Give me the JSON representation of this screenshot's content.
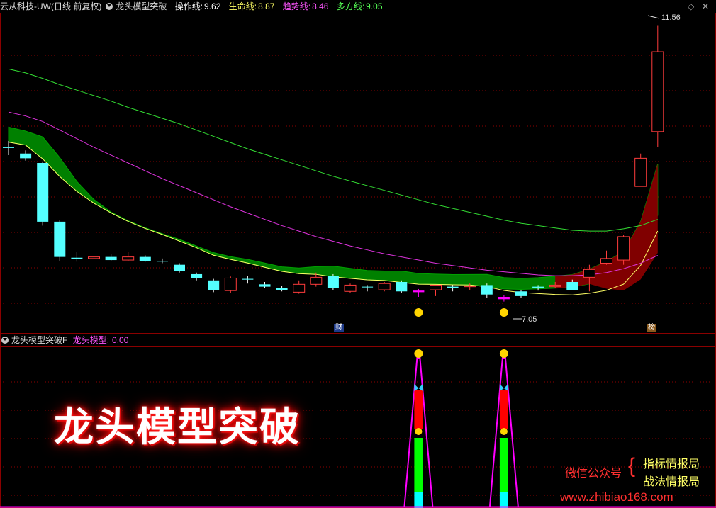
{
  "header_main": {
    "app_name": "云从科技-UW",
    "period": "(日线 前复权)",
    "indicator_name": "龙头模型突破",
    "lines": [
      {
        "label": "操作线:",
        "value": "9.62",
        "color": "#ffffff"
      },
      {
        "label": "生命线:",
        "value": "8.87",
        "color": "#ffff66"
      },
      {
        "label": "趋势线:",
        "value": "8.46",
        "color": "#ff55ff"
      },
      {
        "label": "多方线:",
        "value": "9.05",
        "color": "#55ff55"
      }
    ]
  },
  "header_sub": {
    "indicator_name": "龙头模型突破F",
    "label": "龙头模型:",
    "value": "0.00"
  },
  "price_labels": {
    "high": "11.56",
    "low": "7.05"
  },
  "markers": {
    "finance": "财",
    "rank": "榜"
  },
  "overlay_title": "龙头模型突破",
  "watermark": {
    "wechat": "微信公众号",
    "brace": "{",
    "name1": "指标情报局",
    "name2": "战法情报局",
    "url": "www.zhibiao168.com"
  },
  "colors": {
    "up": "#ff3c3c",
    "down": "#54ffff",
    "signal": "#ff00ff",
    "band": "#008000",
    "band_red": "#800000",
    "ma_green": "#33dd33",
    "ma_magenta": "#dd33dd",
    "ma_yellow": "#ffff66",
    "grid": "#8b0000"
  },
  "chart_data": {
    "type": "candlestick",
    "candles": [
      {
        "o": 10.0,
        "h": 10.08,
        "l": 9.9,
        "c": 10.0
      },
      {
        "o": 9.92,
        "h": 9.96,
        "l": 9.83,
        "c": 9.86
      },
      {
        "o": 9.8,
        "h": 9.82,
        "l": 9.0,
        "c": 9.05
      },
      {
        "o": 9.05,
        "h": 9.07,
        "l": 8.55,
        "c": 8.6
      },
      {
        "o": 8.59,
        "h": 8.66,
        "l": 8.54,
        "c": 8.57
      },
      {
        "o": 8.58,
        "h": 8.62,
        "l": 8.52,
        "c": 8.6
      },
      {
        "o": 8.56,
        "h": 8.64,
        "l": 8.55,
        "c": 8.6
      },
      {
        "o": 8.6,
        "h": 8.66,
        "l": 8.55,
        "c": 8.56
      },
      {
        "o": 8.6,
        "h": 8.62,
        "l": 8.54,
        "c": 8.55
      },
      {
        "o": 8.55,
        "h": 8.58,
        "l": 8.52,
        "c": 8.54
      },
      {
        "o": 8.5,
        "h": 8.52,
        "l": 8.4,
        "c": 8.42
      },
      {
        "o": 8.38,
        "h": 8.4,
        "l": 8.3,
        "c": 8.33
      },
      {
        "o": 8.3,
        "h": 8.32,
        "l": 8.15,
        "c": 8.18
      },
      {
        "o": 8.17,
        "h": 8.35,
        "l": 8.14,
        "c": 8.33
      },
      {
        "o": 8.32,
        "h": 8.36,
        "l": 8.26,
        "c": 8.31
      },
      {
        "o": 8.25,
        "h": 8.28,
        "l": 8.2,
        "c": 8.22
      },
      {
        "o": 8.2,
        "h": 8.23,
        "l": 8.16,
        "c": 8.18
      },
      {
        "o": 8.15,
        "h": 8.3,
        "l": 8.13,
        "c": 8.25
      },
      {
        "o": 8.25,
        "h": 8.4,
        "l": 8.22,
        "c": 8.34
      },
      {
        "o": 8.36,
        "h": 8.38,
        "l": 8.18,
        "c": 8.2
      },
      {
        "o": 8.16,
        "h": 8.26,
        "l": 8.14,
        "c": 8.24
      },
      {
        "o": 8.22,
        "h": 8.24,
        "l": 8.16,
        "c": 8.22
      },
      {
        "o": 8.18,
        "h": 8.28,
        "l": 8.16,
        "c": 8.26
      },
      {
        "o": 8.28,
        "h": 8.3,
        "l": 8.14,
        "c": 8.16
      },
      {
        "o": 8.17,
        "h": 8.19,
        "l": 8.09,
        "c": 8.15
      },
      {
        "o": 8.18,
        "h": 8.24,
        "l": 8.1,
        "c": 8.24
      },
      {
        "o": 8.2,
        "h": 8.24,
        "l": 8.16,
        "c": 8.22
      },
      {
        "o": 8.22,
        "h": 8.26,
        "l": 8.18,
        "c": 8.23
      },
      {
        "o": 8.24,
        "h": 8.26,
        "l": 8.08,
        "c": 8.12
      },
      {
        "o": 8.09,
        "h": 8.11,
        "l": 8.03,
        "c": 8.06
      },
      {
        "o": 8.1,
        "h": 8.18,
        "l": 8.08,
        "c": 8.16
      },
      {
        "o": 8.2,
        "h": 8.24,
        "l": 8.17,
        "c": 8.22
      },
      {
        "o": 8.22,
        "h": 8.28,
        "l": 8.2,
        "c": 8.24
      },
      {
        "o": 8.18,
        "h": 8.31,
        "l": 8.18,
        "c": 8.28
      },
      {
        "o": 8.34,
        "h": 8.5,
        "l": 8.16,
        "c": 8.44
      },
      {
        "o": 8.52,
        "h": 8.68,
        "l": 8.5,
        "c": 8.58
      },
      {
        "o": 8.56,
        "h": 8.88,
        "l": 8.5,
        "c": 8.86
      },
      {
        "o": 9.5,
        "h": 9.92,
        "l": 9.5,
        "c": 9.86
      },
      {
        "o": 10.2,
        "h": 11.56,
        "l": 10.0,
        "c": 11.22
      }
    ],
    "up_flags": [
      0,
      0,
      0,
      0,
      0,
      1,
      0,
      1,
      0,
      0,
      0,
      0,
      0,
      1,
      0,
      0,
      0,
      1,
      1,
      0,
      1,
      0,
      1,
      0,
      0,
      1,
      0,
      1,
      0,
      0,
      0,
      0,
      1,
      0,
      1,
      1,
      1,
      1,
      1
    ],
    "magenta_flags": [
      0,
      0,
      0,
      0,
      0,
      0,
      0,
      0,
      0,
      0,
      0,
      0,
      0,
      0,
      0,
      0,
      0,
      0,
      0,
      0,
      0,
      0,
      0,
      0,
      1,
      0,
      0,
      0,
      0,
      1,
      0,
      0,
      0,
      0,
      0,
      0,
      0,
      0,
      0
    ],
    "signal_bars": [
      24,
      29
    ],
    "sub_value": "0.00",
    "ma_green": [
      11.0,
      10.95,
      10.88,
      10.8,
      10.73,
      10.66,
      10.59,
      10.51,
      10.44,
      10.37,
      10.3,
      10.22,
      10.14,
      10.06,
      9.98,
      9.91,
      9.84,
      9.77,
      9.7,
      9.63,
      9.57,
      9.51,
      9.45,
      9.39,
      9.33,
      9.27,
      9.22,
      9.17,
      9.12,
      9.07,
      9.03,
      9.0,
      8.97,
      8.94,
      8.93,
      8.93,
      8.96,
      9.0,
      9.08
    ],
    "ma_magenta": [
      10.45,
      10.4,
      10.33,
      10.22,
      10.11,
      10.0,
      9.9,
      9.8,
      9.7,
      9.6,
      9.51,
      9.42,
      9.33,
      9.24,
      9.16,
      9.08,
      9.0,
      8.93,
      8.86,
      8.8,
      8.74,
      8.69,
      8.64,
      8.6,
      8.56,
      8.52,
      8.49,
      8.46,
      8.43,
      8.41,
      8.39,
      8.37,
      8.36,
      8.36,
      8.37,
      8.4,
      8.45,
      8.52,
      8.62
    ]
  }
}
